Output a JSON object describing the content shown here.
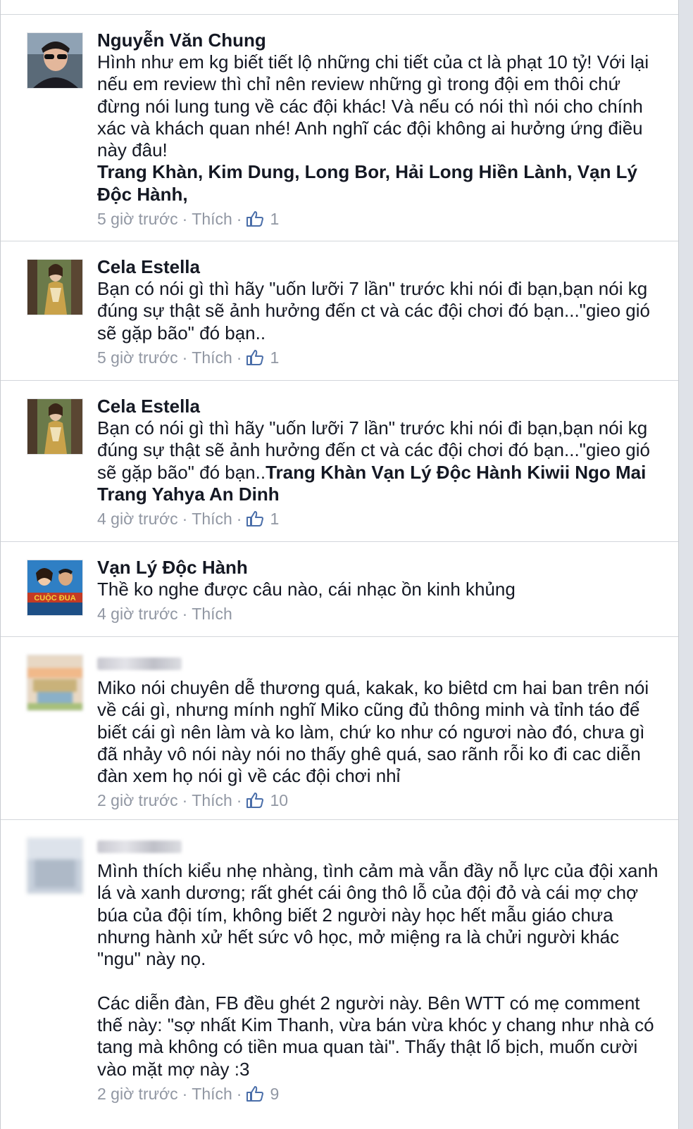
{
  "comments": [
    {
      "name": "Nguyễn Văn Chung",
      "text": "Hình như em kg biết tiết lộ những chi tiết của ct là phạt 10 tỷ! Với lại nếu em review thì chỉ nên review những gì trong đội em thôi chứ đừng nói lung tung về các đội khác! Và nếu có nói thì nói cho chính xác và khách quan nhé! Anh nghĩ các đội không ai hưởng ứng điều này đâu!",
      "tags": "Trang Khàn, Kim Dung, Long Bor, Hải Long Hiền Lành, Vạn Lý Độc Hành,",
      "time": "5 giờ trước",
      "like_label": "Thích",
      "likes": "1"
    },
    {
      "name": "Cela Estella",
      "text": "Bạn có nói gì thì hãy \"uốn lưỡi 7 lần\" trước khi nói đi bạn,bạn nói kg đúng sự thật sẽ ảnh hưởng đến ct và các đội chơi đó bạn...\"gieo gió sẽ gặp bão\" đó bạn..",
      "time": "5 giờ trước",
      "like_label": "Thích",
      "likes": "1"
    },
    {
      "name": "Cela Estella",
      "text": "Bạn có nói gì thì hãy \"uốn lưỡi 7 lần\" trước khi nói đi bạn,bạn nói kg đúng sự thật sẽ ảnh hưởng đến ct và các đội chơi đó bạn...\"gieo gió sẽ gặp bão\" đó bạn..",
      "tags": "Trang Khàn Vạn Lý Độc Hành Kiwii Ngo Mai Trang Yahya An Dinh",
      "time": "4 giờ trước",
      "like_label": "Thích",
      "likes": "1"
    },
    {
      "name": "Vạn Lý Độc Hành",
      "text": "Thề ko nghe được câu nào, cái nhạc ồn kinh khủng",
      "time": "4 giờ trước",
      "like_label": "Thích"
    },
    {
      "text": "Miko nói chuyên dễ thương quá, kakak, ko biêtd cm hai ban trên nói về cái gì, nhưng mính nghĩ Miko cũng đủ thông minh và tỉnh táo để biết cái gì nên làm và ko làm, chứ ko như có ngươi nào đó, chưa gì đã nhảy vô nói này nói no thấy ghê quá, sao rãnh rỗi ko đi cac diễn đàn xem họ nói gì về các đội chơi nhỉ",
      "time": "2 giờ trước",
      "like_label": "Thích",
      "likes": "10"
    },
    {
      "text": "Mình thích kiểu nhẹ nhàng, tình cảm mà vẫn đầy nỗ lực của đội xanh lá và xanh dương; rất ghét cái ông thô lỗ của đội đỏ và cái mợ chợ búa của đội tím, không biết 2 người này học hết mẫu giáo chưa nhưng hành xử hết sức vô học, mở miệng ra là chửi người khác \"ngu\" này nọ.\n\nCác diễn đàn, FB đều ghét 2 người này. Bên WTT có mẹ comment thế này: \"sợ nhất Kim Thanh, vừa bán vừa khóc y chang như nhà có tang mà không có tiền mua quan tài\". Thấy thật lố bịch, muốn cười vào mặt mợ này :3",
      "time": "2 giờ trước",
      "like_label": "Thích",
      "likes": "9"
    }
  ],
  "avatar_texts": {
    "race_banner": "CUỘC ĐUA"
  }
}
